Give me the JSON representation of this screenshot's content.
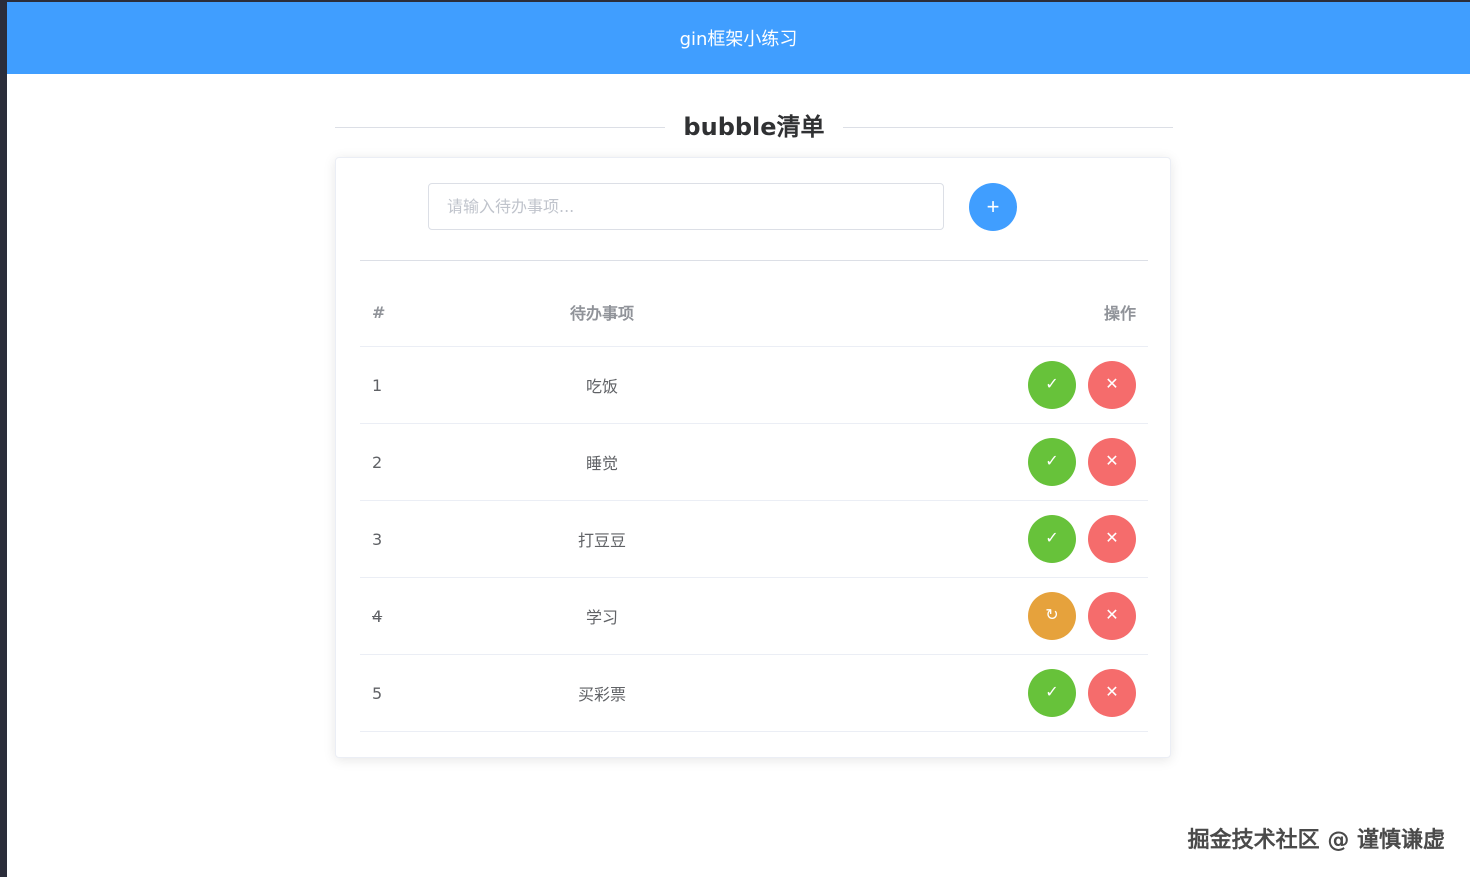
{
  "header": {
    "title": "gin框架小练习"
  },
  "page": {
    "title": "bubble清单"
  },
  "form": {
    "placeholder": "请输入待办事项...",
    "add_icon": "plus-icon",
    "add_symbol": "+"
  },
  "table": {
    "columns": [
      "#",
      "待办事项",
      "操作"
    ],
    "rows": [
      {
        "index": "1",
        "task": "吃饭",
        "status": "pending",
        "action_icon": "check-icon",
        "action_symbol": "✓"
      },
      {
        "index": "2",
        "task": "睡觉",
        "status": "pending",
        "action_icon": "check-icon",
        "action_symbol": "✓"
      },
      {
        "index": "3",
        "task": "打豆豆",
        "status": "pending",
        "action_icon": "check-icon",
        "action_symbol": "✓"
      },
      {
        "index": "4",
        "task": "学习",
        "status": "done",
        "action_icon": "refresh-icon",
        "action_symbol": "↻"
      },
      {
        "index": "5",
        "task": "买彩票",
        "status": "pending",
        "action_icon": "check-icon",
        "action_symbol": "✓"
      }
    ],
    "delete_icon": "close-icon",
    "delete_symbol": "✕"
  },
  "watermark": "掘金技术社区 @ 谨慎谦虚",
  "colors": {
    "primary": "#409eff",
    "success": "#67c23a",
    "warning": "#e6a23c",
    "danger": "#f56c6c"
  }
}
